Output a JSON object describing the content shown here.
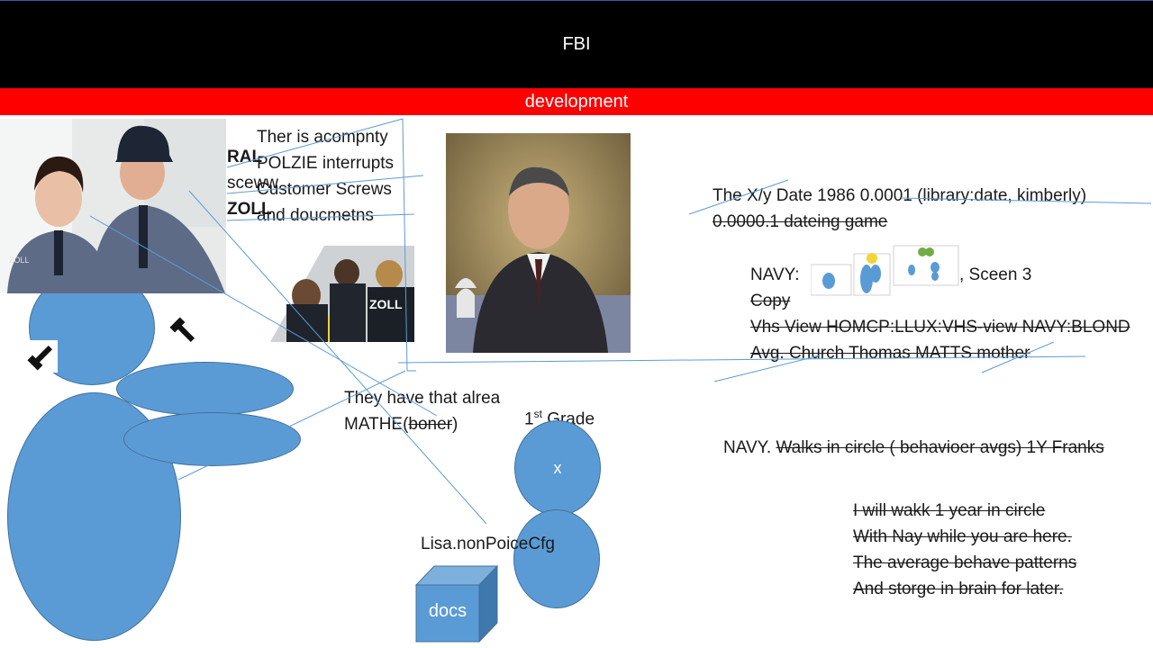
{
  "header": {
    "title": "FBI"
  },
  "banner": {
    "label": "development"
  },
  "left_cut_labels": [
    "RAL",
    "sceww",
    "ZOLL"
  ],
  "note_block": [
    "Ther is acompnty",
    "POLZIE interrupts",
    "Customer Screws",
    "and doucmetns"
  ],
  "middle_note": {
    "line1": "They have that alrea",
    "line2_prefix": "MATHE(",
    "line2_strike": "boner",
    "line2_suffix": ")"
  },
  "grade_label": {
    "number": "1",
    "suffix": "st",
    "text": " Grade"
  },
  "circle_x_label": "x",
  "lisa_label": "Lisa.nonPoiceCfg",
  "docs_label": "docs",
  "right_block": {
    "date_line": "The X/y Date 1986  0.0001  (library:date, kimberly)",
    "dateing_line": "0.0000.1 dateing game",
    "navy_prefix": "NAVY:",
    "navy_suffix": ", Sceen 3",
    "copy_line": "Copy",
    "vhs_line": "Vhs View HOMCP:LLUX:VHS-view NAVY:BLOND",
    "church_line": "Avg. Church Thomas MATTS mother",
    "navy2_prefix": "NAVY.  ",
    "navy2_strike": "Walks in circle ( behavioer avgs) 1Y Franks"
  },
  "promise_block": [
    "I will wakk 1 year in circle",
    "With Nay while you are here.",
    "The average behave patterns",
    "And storge in brain for later."
  ],
  "colors": {
    "header": "#000000",
    "banner": "#ff0000",
    "shape_fill": "#5b9bd5",
    "line": "#5b9bd5"
  }
}
